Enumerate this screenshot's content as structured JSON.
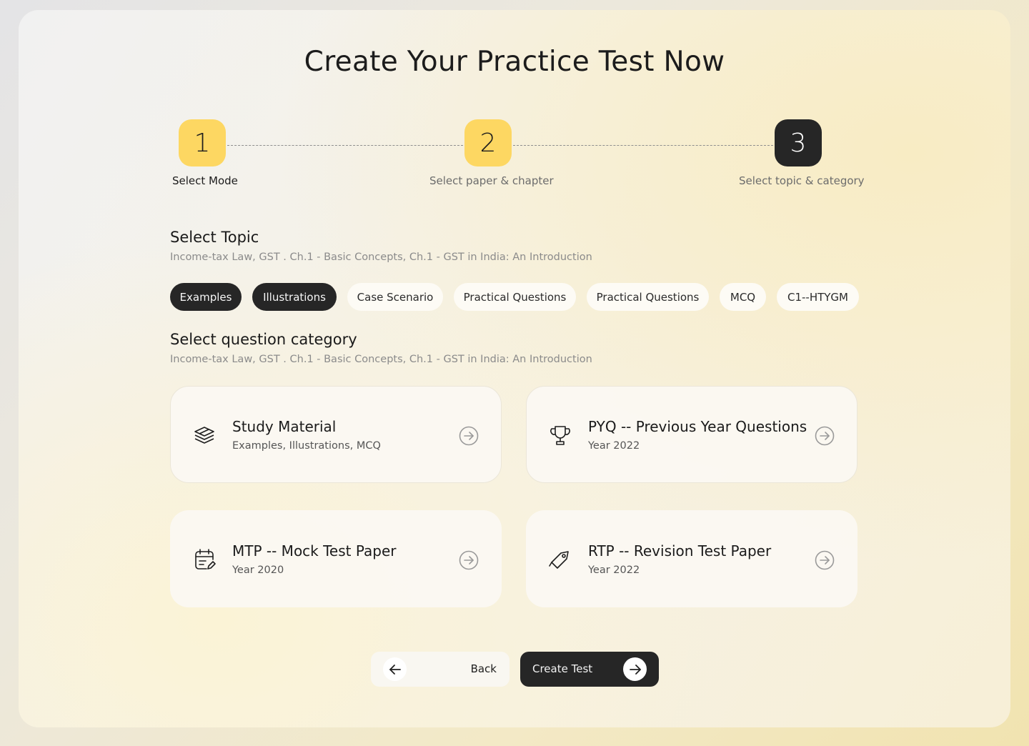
{
  "page": {
    "title": "Create Your Practice Test Now"
  },
  "stepper": {
    "steps": [
      {
        "number": "1",
        "label": "Select Mode",
        "state": "done"
      },
      {
        "number": "2",
        "label": "Select paper & chapter",
        "state": "done"
      },
      {
        "number": "3",
        "label": "Select topic & category",
        "state": "active"
      }
    ]
  },
  "topic": {
    "title": "Select Topic",
    "subtitle": "Income-tax Law, GST . Ch.1 - Basic Concepts, Ch.1 - GST in India: An Introduction",
    "chips": [
      {
        "label": "Examples",
        "selected": true
      },
      {
        "label": "Illustrations",
        "selected": true
      },
      {
        "label": "Case Scenario",
        "selected": false
      },
      {
        "label": "Practical Questions",
        "selected": false
      },
      {
        "label": "Practical Questions",
        "selected": false
      },
      {
        "label": "MCQ",
        "selected": false
      },
      {
        "label": "C1--HTYGM",
        "selected": false
      }
    ]
  },
  "category": {
    "title": "Select question category",
    "subtitle": "Income-tax Law, GST . Ch.1 - Basic Concepts, Ch.1 - GST in India: An Introduction",
    "cards": [
      {
        "title": "Study Material",
        "subtitle": "Examples, Illustrations, MCQ",
        "icon": "layers-icon"
      },
      {
        "title": "PYQ -- Previous Year Questions",
        "subtitle": "Year 2022",
        "icon": "trophy-icon"
      },
      {
        "title": "MTP -- Mock Test Paper",
        "subtitle": "Year 2020",
        "icon": "calendar-edit-icon"
      },
      {
        "title": "RTP -- Revision Test Paper",
        "subtitle": "Year 2022",
        "icon": "tag-icon"
      }
    ]
  },
  "actions": {
    "back_label": "Back",
    "create_label": "Create Test"
  },
  "colors": {
    "accent_yellow": "#fdd762",
    "dark": "#262626"
  }
}
